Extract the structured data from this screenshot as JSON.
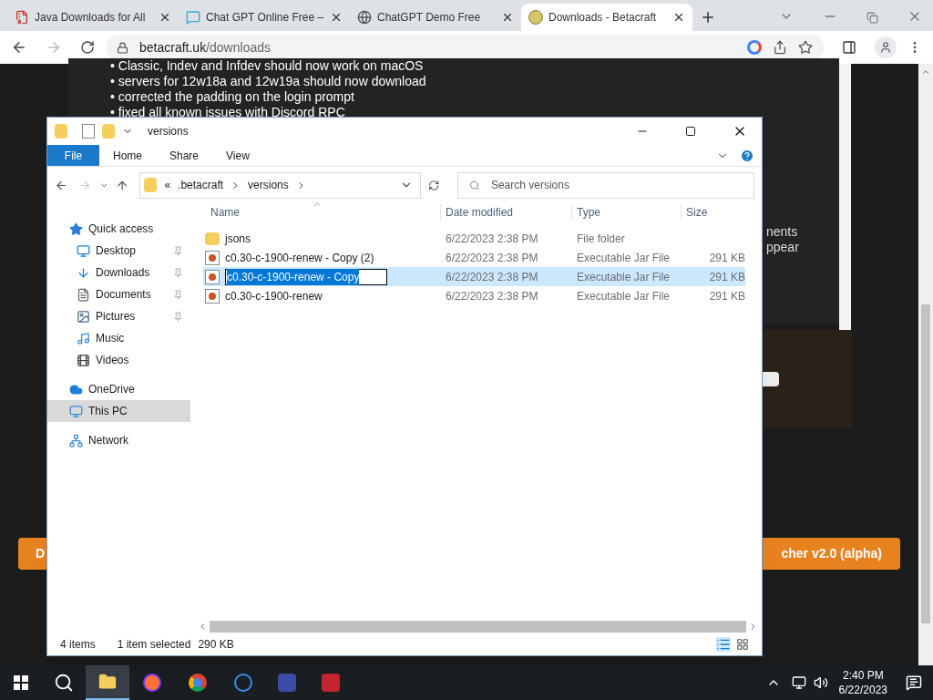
{
  "browser": {
    "tabs": [
      {
        "title": "Java Downloads for All",
        "selected": false,
        "kind": "java"
      },
      {
        "title": "Chat GPT Online Free –",
        "selected": false,
        "kind": "chat"
      },
      {
        "title": "ChatGPT Demo Free",
        "selected": false,
        "kind": "globe"
      },
      {
        "title": "Downloads - Betacraft",
        "selected": true,
        "kind": "betacraft"
      }
    ],
    "url_host": "betacraft.uk",
    "url_path": "/downloads"
  },
  "page": {
    "bullets": [
      "• Classic, Indev and Infdev should now work on macOS",
      "• servers for 12w18a and 12w19a should now download",
      "• corrected the padding on the login prompt",
      "• fixed all known issues with Discord RPC"
    ],
    "right_fragments": [
      "nents",
      "ppear"
    ],
    "left_button": "D",
    "right_button": "cher v2.0 (alpha)"
  },
  "explorer": {
    "title": "versions",
    "ribbon_tabs": [
      {
        "label": "File",
        "selected": true
      },
      {
        "label": "Home",
        "selected": false
      },
      {
        "label": "Share",
        "selected": false
      },
      {
        "label": "View",
        "selected": false
      }
    ],
    "breadcrumb": [
      "«",
      ".betacraft",
      "versions"
    ],
    "search_placeholder": "Search versions",
    "columns": [
      "Name",
      "Date modified",
      "Type",
      "Size"
    ],
    "sidebar": [
      {
        "label": "Quick access",
        "kind": "star",
        "pinned": false,
        "selected": false,
        "indent": false
      },
      {
        "label": "Desktop",
        "kind": "desktop",
        "pinned": true,
        "selected": false,
        "indent": true
      },
      {
        "label": "Downloads",
        "kind": "download",
        "pinned": true,
        "selected": false,
        "indent": true
      },
      {
        "label": "Documents",
        "kind": "document",
        "pinned": true,
        "selected": false,
        "indent": true
      },
      {
        "label": "Pictures",
        "kind": "picture",
        "pinned": true,
        "selected": false,
        "indent": true
      },
      {
        "label": "Music",
        "kind": "music",
        "pinned": false,
        "selected": false,
        "indent": true
      },
      {
        "label": "Videos",
        "kind": "video",
        "pinned": false,
        "selected": false,
        "indent": true
      },
      {
        "label": "OneDrive",
        "kind": "cloud",
        "pinned": false,
        "selected": false,
        "indent": false
      },
      {
        "label": "This PC",
        "kind": "pc",
        "pinned": false,
        "selected": true,
        "indent": false
      },
      {
        "label": "Network",
        "kind": "network",
        "pinned": false,
        "selected": false,
        "indent": false
      }
    ],
    "files": [
      {
        "name": "jsons",
        "date": "6/22/2023 2:38 PM",
        "type": "File folder",
        "kind": "folder",
        "selected": false,
        "renaming": false
      },
      {
        "name": "c0.30-c-1900-renew - Copy (2)",
        "date": "6/22/2023 2:38 PM",
        "type": "Executable Jar File",
        "size": "291 KB",
        "kind": "jar",
        "selected": false,
        "renaming": false
      },
      {
        "name": "c0.30-c-1900-renew - Copy",
        "date": "6/22/2023 2:38 PM",
        "type": "Executable Jar File",
        "size": "291 KB",
        "kind": "jar",
        "selected": true,
        "renaming": true
      },
      {
        "name": "c0.30-c-1900-renew",
        "date": "6/22/2023 2:38 PM",
        "type": "Executable Jar File",
        "size": "291 KB",
        "kind": "jar",
        "selected": false,
        "renaming": false
      }
    ],
    "status": [
      "4 items",
      "1 item selected",
      "290 KB"
    ]
  },
  "taskbar": {
    "time": "2:40 PM",
    "date": "6/22/2023"
  }
}
